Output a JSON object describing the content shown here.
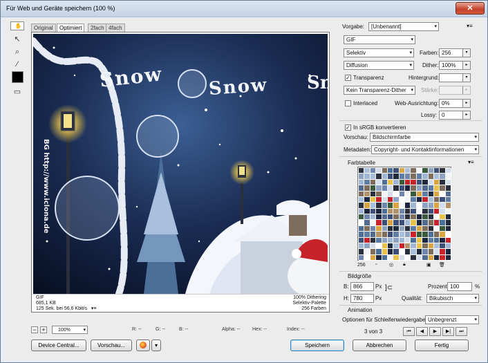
{
  "window": {
    "title": "Für Web und Geräte speichern (100 %)",
    "close": "✕"
  },
  "tools": [
    "hand-icon",
    "slice-select-icon",
    "zoom-icon",
    "eyedropper-icon"
  ],
  "tabs": [
    "Original",
    "Optimiert",
    "2fach",
    "4fach"
  ],
  "preview": {
    "snow_text": "Snow",
    "watermark": "BG http://www.iclona.de",
    "info_left": [
      "GIF",
      "685,1 KB",
      "125 Sek. bei 56,6 Kbit/s"
    ],
    "info_right": [
      "100% Dithering",
      "Selektiv-Palette",
      "256 Farben"
    ]
  },
  "statusbar": {
    "zoom": "100%",
    "r": "R: --",
    "g": "G: --",
    "b": "B: --",
    "alpha": "Alpha: --",
    "hex": "Hex: --",
    "index": "Index: --"
  },
  "bottom_buttons": {
    "device_central": "Device Central...",
    "preview": "Vorschau...",
    "save": "Speichern",
    "cancel": "Abbrechen",
    "done": "Fertig"
  },
  "settings": {
    "preset_label": "Vorgabe:",
    "preset_value": "[Unbenannt]",
    "format": "GIF",
    "reduction": "Selektiv",
    "colors_label": "Farben:",
    "colors_value": "256",
    "dither_algo": "Diffusion",
    "dither_label": "Dither:",
    "dither_value": "100%",
    "transparency_label": "Transparenz",
    "matte_label": "Hintergrund:",
    "transp_dither": "Kein Transparenz-Dither",
    "amount_label": "Stärke:",
    "interlaced_label": "Interlaced",
    "websnap_label": "Web-Ausrichtung:",
    "websnap_value": "0%",
    "lossy_label": "Lossy:",
    "lossy_value": "0",
    "srgb_label": "In sRGB konvertieren",
    "preview_label": "Vorschau:",
    "preview_value": "Bildschirmfarbe",
    "metadata_label": "Metadaten:",
    "metadata_value": "Copyright- und Kontaktinformationen"
  },
  "color_table": {
    "label": "Farbtabelle",
    "count": "256"
  },
  "image_size": {
    "label": "Bildgröße",
    "w_label": "B:",
    "w_value": "866",
    "w_unit": "Px",
    "h_label": "H:",
    "h_value": "780",
    "h_unit": "Px",
    "percent_label": "Prozent:",
    "percent_value": "100",
    "percent_unit": "%",
    "quality_label": "Qualität:",
    "quality_value": "Bikubisch"
  },
  "animation": {
    "label": "Animation",
    "loop_label": "Optionen für Schleifenwiedergabe:",
    "loop_value": "Unbegrenzt",
    "frame": "3 von 3"
  },
  "colors": {
    "accent": "#3c7fb1",
    "night_sky": "#0d1a34",
    "snow": "#ffffff"
  }
}
